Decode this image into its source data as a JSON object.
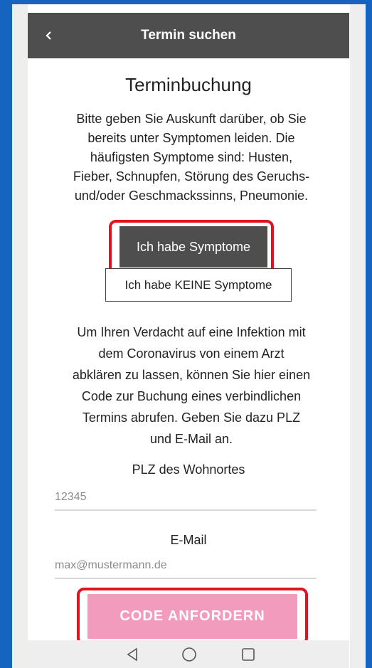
{
  "app": {
    "title": "Termin suchen"
  },
  "page": {
    "heading": "Terminbuchung",
    "intro_lines": [
      "Bitte geben Sie Auskunft darüber, ob Sie",
      "bereits unter Symptomen leiden. Die",
      "häufigsten Symptome sind: Husten,",
      "Fieber, Schnupfen, Störung des Geruchs-",
      "und/oder Geschmackssinns, Pneumonie."
    ],
    "btn_yes": "Ich habe Symptome",
    "btn_no": "Ich habe KEINE Symptome",
    "explain_lines": [
      "Um Ihren Verdacht auf eine Infektion mit",
      "dem Coronavirus von einem Arzt",
      "abklären zu lassen, können Sie hier einen",
      "Code zur Buchung eines verbindlichen",
      "Termins abrufen. Geben Sie dazu PLZ",
      "und E-Mail an."
    ]
  },
  "form": {
    "plz_label": "PLZ des Wohnortes",
    "plz_placeholder": "12345",
    "email_label": "E-Mail",
    "email_placeholder": "max@mustermann.de",
    "submit": "CODE ANFORDERN"
  },
  "icons": {
    "back": "chevron-left-icon",
    "nav_back": "triangle-back-icon",
    "nav_home": "circle-home-icon",
    "nav_recents": "square-recents-icon"
  },
  "colors": {
    "appbar": "#4e4e4e",
    "submit": "#f29bbd",
    "highlight": "#e0141e",
    "frame": "#1565c0"
  }
}
